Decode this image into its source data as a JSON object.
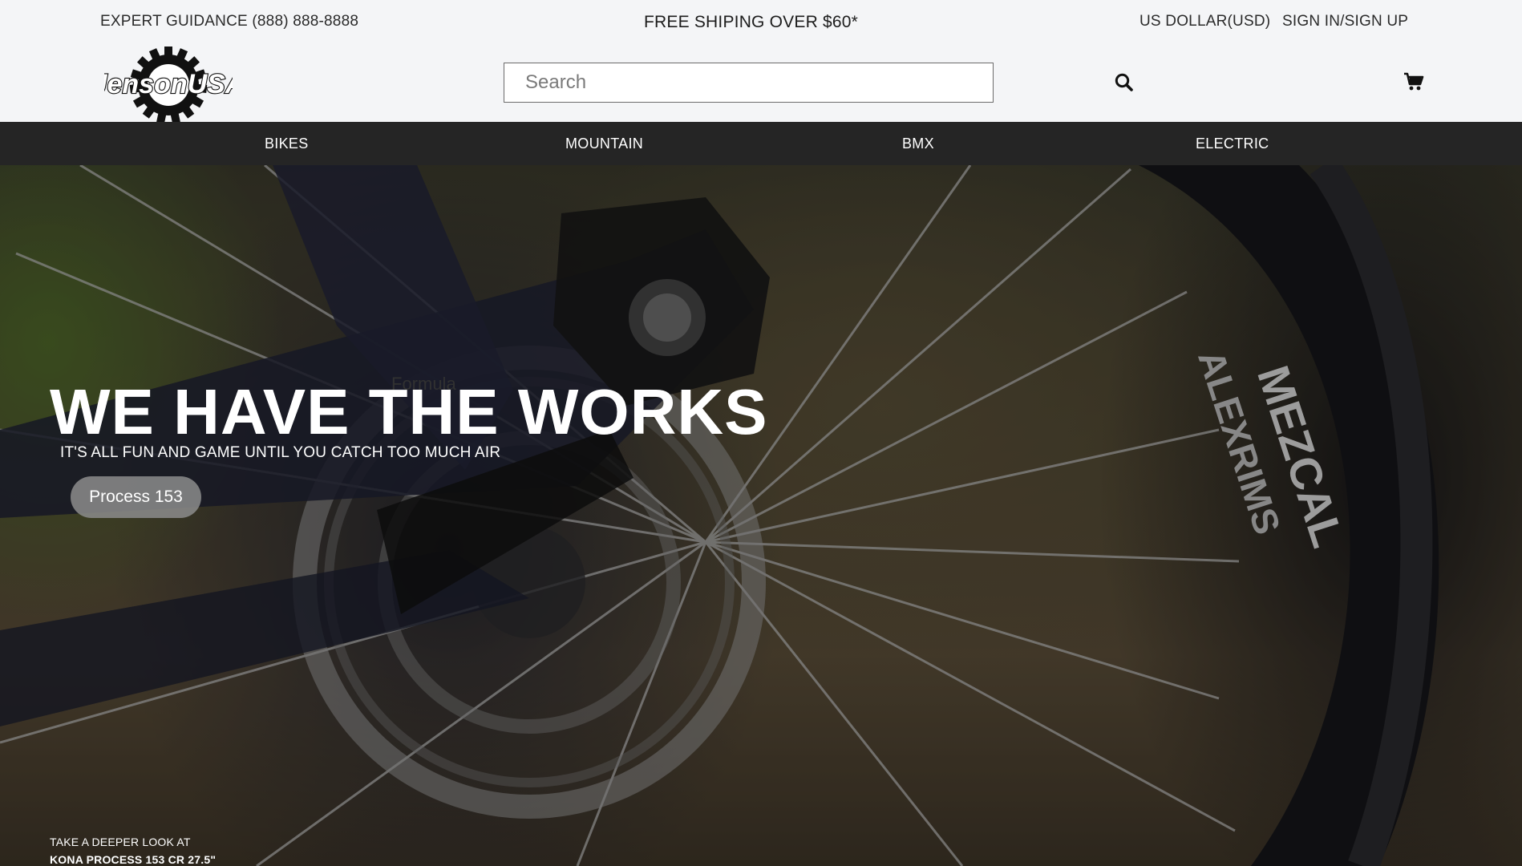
{
  "topbar": {
    "guidance": "EXPERT GUIDANCE (888) 888-8888",
    "shipping": "FREE SHIPING OVER $60*",
    "currency": "US DOLLAR(USD)",
    "signin": "SIGN IN/SIGN UP"
  },
  "logo": {
    "text": "JensonUSA"
  },
  "search": {
    "placeholder": "Search",
    "value": ""
  },
  "icons": {
    "search": "search-icon",
    "cart": "cart-icon"
  },
  "nav": {
    "items": [
      {
        "label": "BIKES"
      },
      {
        "label": "MOUNTAIN"
      },
      {
        "label": "BMX"
      },
      {
        "label": "ELECTRIC"
      }
    ]
  },
  "hero": {
    "title": "WE HAVE THE WORKS",
    "subtitle": "IT'S ALL FUN AND GAME UNTIL YOU CATCH TOO MUCH AIR",
    "button_label": "Process 153",
    "image_text": {
      "rim_brand": "ALEXRIMS",
      "tire": "MEZCAL",
      "rotor": "Formula"
    },
    "deeper_line1": "TAKE A DEEPER LOOK AT",
    "deeper_line2": "KONA PROCESS 153 CR 27.5\""
  },
  "colors": {
    "navbar": "#252525",
    "topbar": "#f4f5f7",
    "button": "#8c8c8c"
  }
}
